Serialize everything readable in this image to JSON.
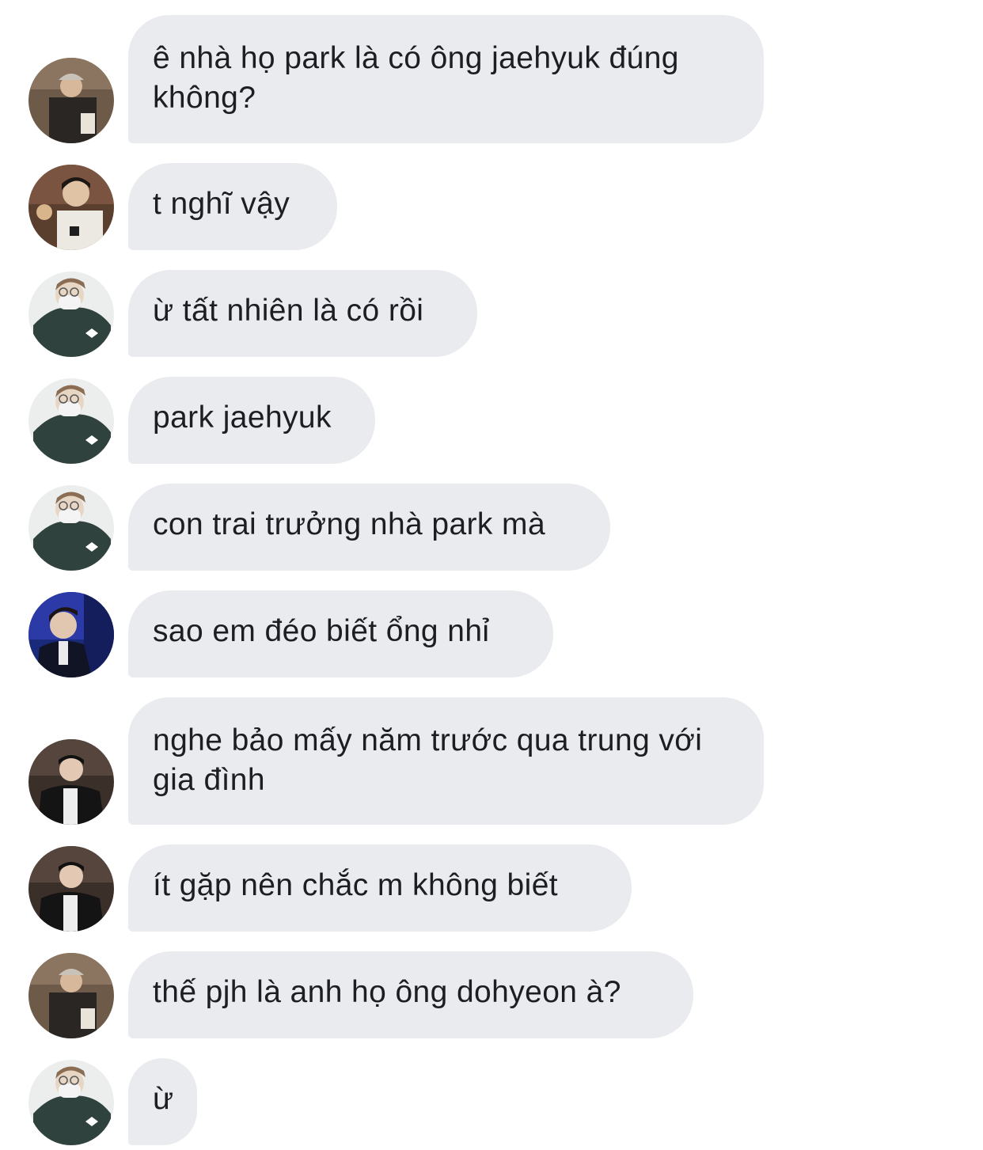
{
  "conversation": {
    "messages": [
      {
        "sender_avatar": "avatar-cap-man-icon",
        "text": "ê nhà họ park là có ông jaehyuk đúng không?"
      },
      {
        "sender_avatar": "avatar-seated-man-icon",
        "text": "t nghĩ vậy"
      },
      {
        "sender_avatar": "avatar-masked-man-icon",
        "text": "ừ tất nhiên là có rồi"
      },
      {
        "sender_avatar": "avatar-masked-man-icon",
        "text": "park jaehyuk"
      },
      {
        "sender_avatar": "avatar-masked-man-icon",
        "text": "con trai trưởng nhà park mà"
      },
      {
        "sender_avatar": "avatar-blue-stage-man-icon",
        "text": "sao em đéo biết ổng nhỉ"
      },
      {
        "sender_avatar": "avatar-black-jacket-man-icon",
        "text": "nghe bảo mấy năm trước qua trung với gia đình"
      },
      {
        "sender_avatar": "avatar-black-jacket-man-icon",
        "text": "ít gặp nên chắc m không biết"
      },
      {
        "sender_avatar": "avatar-cap-man-icon",
        "text": "thế pjh là anh họ ông dohyeon à?"
      },
      {
        "sender_avatar": "avatar-masked-man-icon",
        "text": "ừ"
      }
    ]
  },
  "colors": {
    "background": "#ffffff",
    "bubble": "#e9ebee",
    "text": "#1c1e21"
  }
}
